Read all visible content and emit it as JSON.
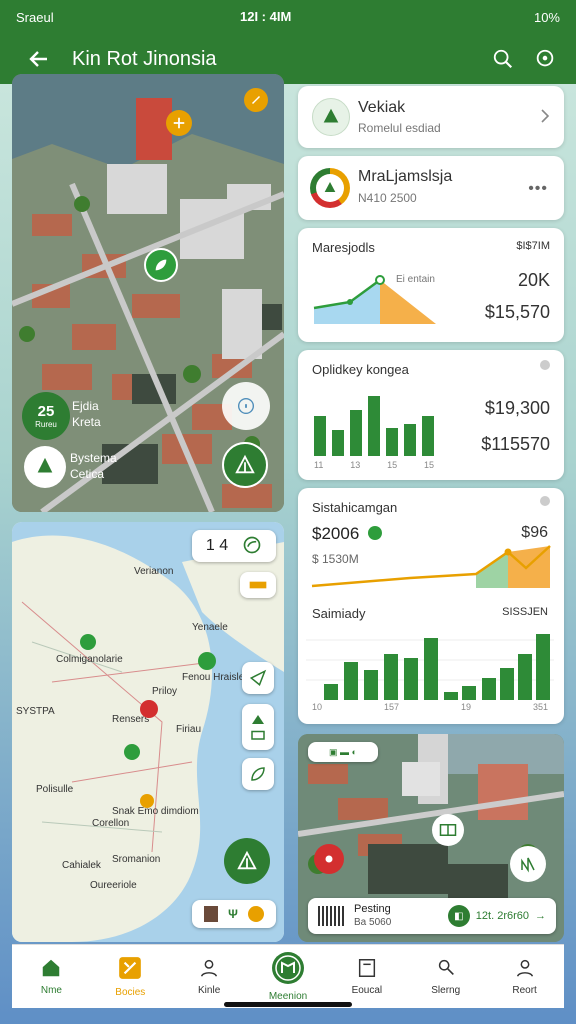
{
  "status": {
    "left": "Sraeul",
    "center": "12I : 4IM",
    "right": "10%"
  },
  "appbar": {
    "title": "Kin Rot Jinonsia",
    "search_icon": "search-icon",
    "location_icon": "location-pin-icon"
  },
  "map_left": {
    "badge_value": "25",
    "badge_sub": "Rureu",
    "badge_l1": "Ejdia",
    "badge_l2": "Kreta",
    "pin_l1": "Bystema",
    "pin_l2": "Cetica"
  },
  "map2": {
    "top_chip": "1 4",
    "labels": [
      "Verianon",
      "Yenaele",
      "Colmiganolarie",
      "Fenou Hraisler",
      "SYSTPA",
      "Priloy",
      "Rensers",
      "Firiau",
      "Polisulle",
      "Snak Emo dimdiom",
      "Corellon",
      "Cahialek",
      "Sromanion",
      "Oureeriole"
    ]
  },
  "cards": {
    "c1": {
      "title": "Vekiak",
      "subtitle": "Romelul esdiad"
    },
    "c2": {
      "title": "MraLjamslsja",
      "subtitle": "N410  2500"
    },
    "c3": {
      "title": "Maresjodls",
      "tag": "$I$7IM",
      "mini": "Ei entain",
      "v1": "20K",
      "v2": "$15,570"
    },
    "c4": {
      "title": "Oplidkey kongea",
      "v1": "$19,300",
      "v2": "$115570",
      "ticks": [
        "11",
        "13",
        "15",
        "15"
      ]
    },
    "c5": {
      "title": "Sistahicamgan",
      "price": "$2006",
      "tag": "$96",
      "sub": "$ 1530M",
      "subtitle2": "Saimiady",
      "tag2": "SISSJEN",
      "ticks": [
        "10",
        "157",
        "19",
        "351"
      ]
    }
  },
  "photo_card": {
    "chip": "Pesting",
    "sub": "Ba 5060",
    "action": "12t. 2r6r60"
  },
  "nav": [
    {
      "label": "Nme",
      "icon": "home-icon"
    },
    {
      "label": "Bocies",
      "icon": "tools-icon"
    },
    {
      "label": "Kinle",
      "icon": "user-icon"
    },
    {
      "label": "Meenion",
      "icon": "map-icon"
    },
    {
      "label": "Eoucal",
      "icon": "bookmark-icon"
    },
    {
      "label": "Slerng",
      "icon": "search-person-icon"
    },
    {
      "label": "Reort",
      "icon": "profile-icon"
    }
  ],
  "colors": {
    "primary": "#2e7d32",
    "accent": "#e8a000",
    "card_bg": "#ffffff"
  }
}
